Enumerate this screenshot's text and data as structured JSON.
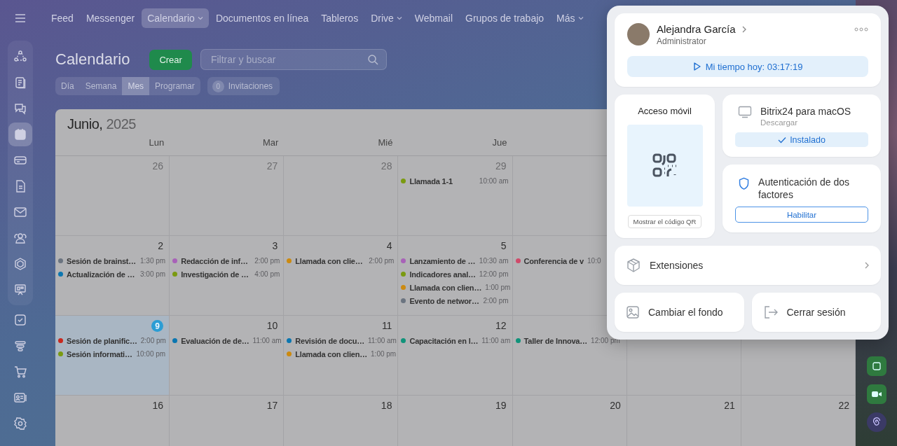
{
  "nav": {
    "items": [
      {
        "label": "Feed",
        "selected": false,
        "dropdown": false
      },
      {
        "label": "Messenger",
        "selected": false,
        "dropdown": false
      },
      {
        "label": "Calendario",
        "selected": true,
        "dropdown": true
      },
      {
        "label": "Documentos en línea",
        "selected": false,
        "dropdown": false
      },
      {
        "label": "Tableros",
        "selected": false,
        "dropdown": false
      },
      {
        "label": "Drive",
        "selected": false,
        "dropdown": true
      },
      {
        "label": "Webmail",
        "selected": false,
        "dropdown": false
      },
      {
        "label": "Grupos de trabajo",
        "selected": false,
        "dropdown": false
      },
      {
        "label": "Más",
        "selected": false,
        "dropdown": true
      }
    ]
  },
  "sidebar": {
    "pinned": [
      {
        "selected": false
      },
      {
        "selected": false
      },
      {
        "selected": false
      },
      {
        "selected": true
      },
      {
        "selected": false
      },
      {
        "selected": false
      },
      {
        "selected": false
      },
      {
        "selected": false
      },
      {
        "selected": false
      },
      {
        "selected": false
      }
    ],
    "items": [
      {
        "selected": false
      },
      {
        "selected": false
      },
      {
        "selected": false
      },
      {
        "selected": false
      },
      {
        "selected": false
      }
    ]
  },
  "toolbar": {
    "title": "Calendario",
    "create_button": "Crear",
    "search": {
      "placeholder": "Filtrar y buscar"
    },
    "views": [
      {
        "label": "Día",
        "selected": false
      },
      {
        "label": "Semana",
        "selected": false
      },
      {
        "label": "Mes",
        "selected": true
      },
      {
        "label": "Programar",
        "selected": false
      }
    ],
    "invitations": {
      "count": "0",
      "label": "Invitaciones"
    }
  },
  "calendar": {
    "month": "Junio,",
    "year": "2025",
    "weekdays": [
      "Lun",
      "Mar",
      "Mié",
      "Jue"
    ],
    "weeks": [
      [
        {
          "day": "26",
          "other_month": true
        },
        {
          "day": "27",
          "other_month": true
        },
        {
          "day": "28",
          "other_month": true
        },
        {
          "day": "29",
          "other_month": true,
          "events": [
            {
              "title": "Llamada 1-1",
              "time": "10:00 am",
              "color": "#7a9a10"
            }
          ]
        }
      ],
      [
        {
          "day": "2",
          "other_month": false,
          "events": [
            {
              "title": "Sesión de brainst…",
              "time": "1:30 pm",
              "color": "#6b7480"
            },
            {
              "title": "Actualización de …",
              "time": "3:00 pm",
              "color": "#0b76b0"
            }
          ]
        },
        {
          "day": "3",
          "other_month": false,
          "events": [
            {
              "title": "Redacción de inf…",
              "time": "2:00 pm",
              "color": "#a862b8"
            },
            {
              "title": "Investigación de …",
              "time": "4:00 pm",
              "color": "#7a9a10"
            }
          ]
        },
        {
          "day": "4",
          "other_month": false,
          "events": [
            {
              "title": "Llamada con clie…",
              "time": "2:00 pm",
              "color": "#cc8a10"
            }
          ]
        },
        {
          "day": "5",
          "other_month": false,
          "events": [
            {
              "title": "Lanzamiento de …",
              "time": "10:30 am",
              "color": "#a862b8"
            },
            {
              "title": "Indicadores anal…",
              "time": "12:00 pm",
              "color": "#7a9a10"
            },
            {
              "title": "Llamada con clien…",
              "time": "1:00 pm",
              "color": "#cc8a10"
            },
            {
              "title": "Evento de networ…",
              "time": "2:00 pm",
              "color": "#6b7480"
            }
          ]
        },
        {
          "events": [
            {
              "title": "Conferencia de v",
              "time": "10:0",
              "color": "#d04a6a"
            }
          ]
        }
      ],
      [
        {
          "day": "9",
          "other_month": false,
          "today": true,
          "events": [
            {
              "title": "Sesión de planific…",
              "time": "2:00 pm",
              "color": "#c8281e"
            },
            {
              "title": "Sesión informati…",
              "time": "10:00 pm",
              "color": "#7a9a10"
            }
          ]
        },
        {
          "day": "10",
          "other_month": false,
          "events": [
            {
              "title": "Evaluación de de…",
              "time": "11:00 am",
              "color": "#0b76b0"
            }
          ]
        },
        {
          "day": "11",
          "other_month": false,
          "events": [
            {
              "title": "Revisión de docu…",
              "time": "11:00 am",
              "color": "#0b76b0"
            },
            {
              "title": "Llamada con clien…",
              "time": "1:00 pm",
              "color": "#cc8a10"
            }
          ]
        },
        {
          "day": "12",
          "other_month": false,
          "events": [
            {
              "title": "Capacitación en l…",
              "time": "11:00 am",
              "color": "#10937a"
            }
          ]
        },
        {
          "events": [
            {
              "title": "Taller de Innova…",
              "time": "12:00 pm",
              "color": "#10937a"
            }
          ]
        }
      ],
      [
        {
          "day": "16",
          "other_month": false
        },
        {
          "day": "17",
          "other_month": false
        },
        {
          "day": "18",
          "other_month": false
        },
        {
          "day": "19",
          "other_month": false
        },
        {
          "day": "20",
          "other_month": false
        },
        {
          "day": "21",
          "other_month": false
        },
        {
          "day": "22",
          "other_month": false
        }
      ]
    ]
  },
  "profile_menu": {
    "user": {
      "name": "Alejandra García",
      "role": "Administrator"
    },
    "timer": "Mi tiempo hoy: 03:17:19",
    "mobile": {
      "title": "Acceso móvil",
      "button": "Mostrar el código QR"
    },
    "desktop_app": {
      "title": "Bitrix24 para macOS",
      "subtitle": "Descargar",
      "status": "Instalado"
    },
    "two_factor": {
      "title": "Autenticación de dos factores",
      "button": "Habilitar"
    },
    "extensions": "Extensiones",
    "change_background": "Cambiar el fondo",
    "logout": "Cerrar sesión"
  }
}
